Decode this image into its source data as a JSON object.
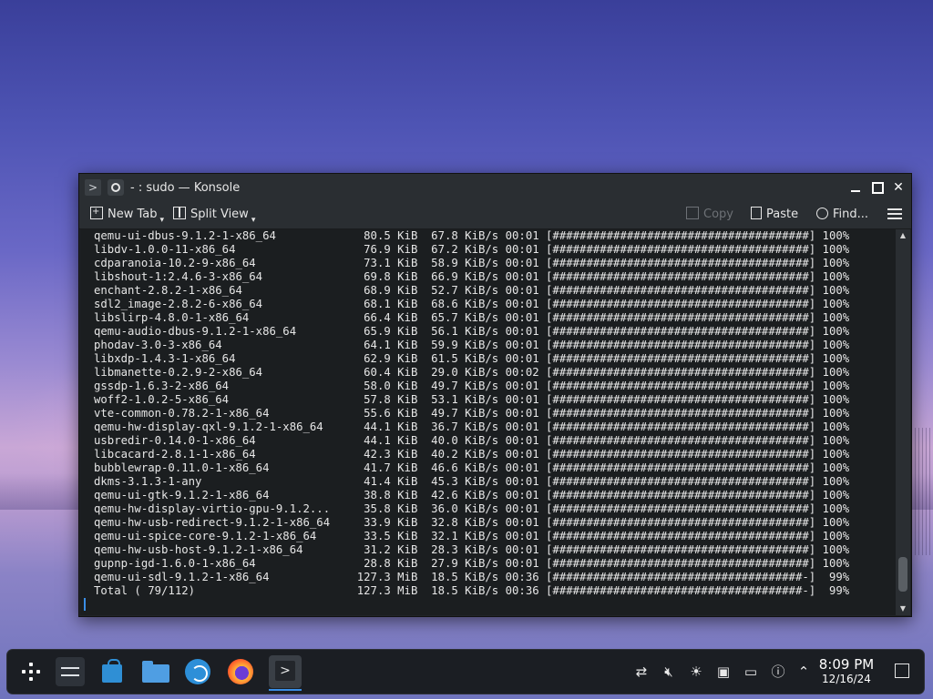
{
  "window": {
    "title": "- : sudo — Konsole"
  },
  "toolbar": {
    "new_tab": "New Tab",
    "split_view": "Split View",
    "copy": "Copy",
    "paste": "Paste",
    "find": "Find..."
  },
  "terminal": {
    "lines": [
      "qemu-ui-dbus-9.1.2-1-x86_64             80.5 KiB  67.8 KiB/s 00:01 [######################################] 100%",
      "libdv-1.0.0-11-x86_64                   76.9 KiB  67.2 KiB/s 00:01 [######################################] 100%",
      "cdparanoia-10.2-9-x86_64                73.1 KiB  58.9 KiB/s 00:01 [######################################] 100%",
      "libshout-1:2.4.6-3-x86_64               69.8 KiB  66.9 KiB/s 00:01 [######################################] 100%",
      "enchant-2.8.2-1-x86_64                  68.9 KiB  52.7 KiB/s 00:01 [######################################] 100%",
      "sdl2_image-2.8.2-6-x86_64               68.1 KiB  68.6 KiB/s 00:01 [######################################] 100%",
      "libslirp-4.8.0-1-x86_64                 66.4 KiB  65.7 KiB/s 00:01 [######################################] 100%",
      "qemu-audio-dbus-9.1.2-1-x86_64          65.9 KiB  56.1 KiB/s 00:01 [######################################] 100%",
      "phodav-3.0-3-x86_64                     64.1 KiB  59.9 KiB/s 00:01 [######################################] 100%",
      "libxdp-1.4.3-1-x86_64                   62.9 KiB  61.5 KiB/s 00:01 [######################################] 100%",
      "libmanette-0.2.9-2-x86_64               60.4 KiB  29.0 KiB/s 00:02 [######################################] 100%",
      "gssdp-1.6.3-2-x86_64                    58.0 KiB  49.7 KiB/s 00:01 [######################################] 100%",
      "woff2-1.0.2-5-x86_64                    57.8 KiB  53.1 KiB/s 00:01 [######################################] 100%",
      "vte-common-0.78.2-1-x86_64              55.6 KiB  49.7 KiB/s 00:01 [######################################] 100%",
      "qemu-hw-display-qxl-9.1.2-1-x86_64      44.1 KiB  36.7 KiB/s 00:01 [######################################] 100%",
      "usbredir-0.14.0-1-x86_64                44.1 KiB  40.0 KiB/s 00:01 [######################################] 100%",
      "libcacard-2.8.1-1-x86_64                42.3 KiB  40.2 KiB/s 00:01 [######################################] 100%",
      "bubblewrap-0.11.0-1-x86_64              41.7 KiB  46.6 KiB/s 00:01 [######################################] 100%",
      "dkms-3.1.3-1-any                        41.4 KiB  45.3 KiB/s 00:01 [######################################] 100%",
      "qemu-ui-gtk-9.1.2-1-x86_64              38.8 KiB  42.6 KiB/s 00:01 [######################################] 100%",
      "qemu-hw-display-virtio-gpu-9.1.2...     35.8 KiB  36.0 KiB/s 00:01 [######################################] 100%",
      "qemu-hw-usb-redirect-9.1.2-1-x86_64     33.9 KiB  32.8 KiB/s 00:01 [######################################] 100%",
      "qemu-ui-spice-core-9.1.2-1-x86_64       33.5 KiB  32.1 KiB/s 00:01 [######################################] 100%",
      "qemu-hw-usb-host-9.1.2-1-x86_64         31.2 KiB  28.3 KiB/s 00:01 [######################################] 100%",
      "gupnp-igd-1.6.0-1-x86_64                28.8 KiB  27.9 KiB/s 00:01 [######################################] 100%",
      "qemu-ui-sdl-9.1.2-1-x86_64             127.3 MiB  18.5 KiB/s 00:36 [#####################################-]  99%",
      "Total ( 79/112)                        127.3 MiB  18.5 KiB/s 00:36 [#####################################-]  99%"
    ]
  },
  "taskbar": {
    "apps": [
      "application-launcher-icon",
      "system-settings-icon",
      "discover-icon",
      "dolphin-files-icon",
      "web-browser-icon",
      "firefox-icon",
      "konsole-icon"
    ],
    "tray": [
      "network-icon",
      "volume-muted-icon",
      "brightness-icon",
      "storage-icon",
      "display-icon",
      "help-icon",
      "tray-expand-icon"
    ],
    "time": "8:09 PM",
    "date": "12/16/24"
  },
  "colors": {
    "window_bg": "#202326",
    "terminal_bg": "#1b1e20",
    "terminal_fg": "#e6e6e6",
    "taskbar_bg": "#1b1e23",
    "accent": "#3a8ee6"
  }
}
